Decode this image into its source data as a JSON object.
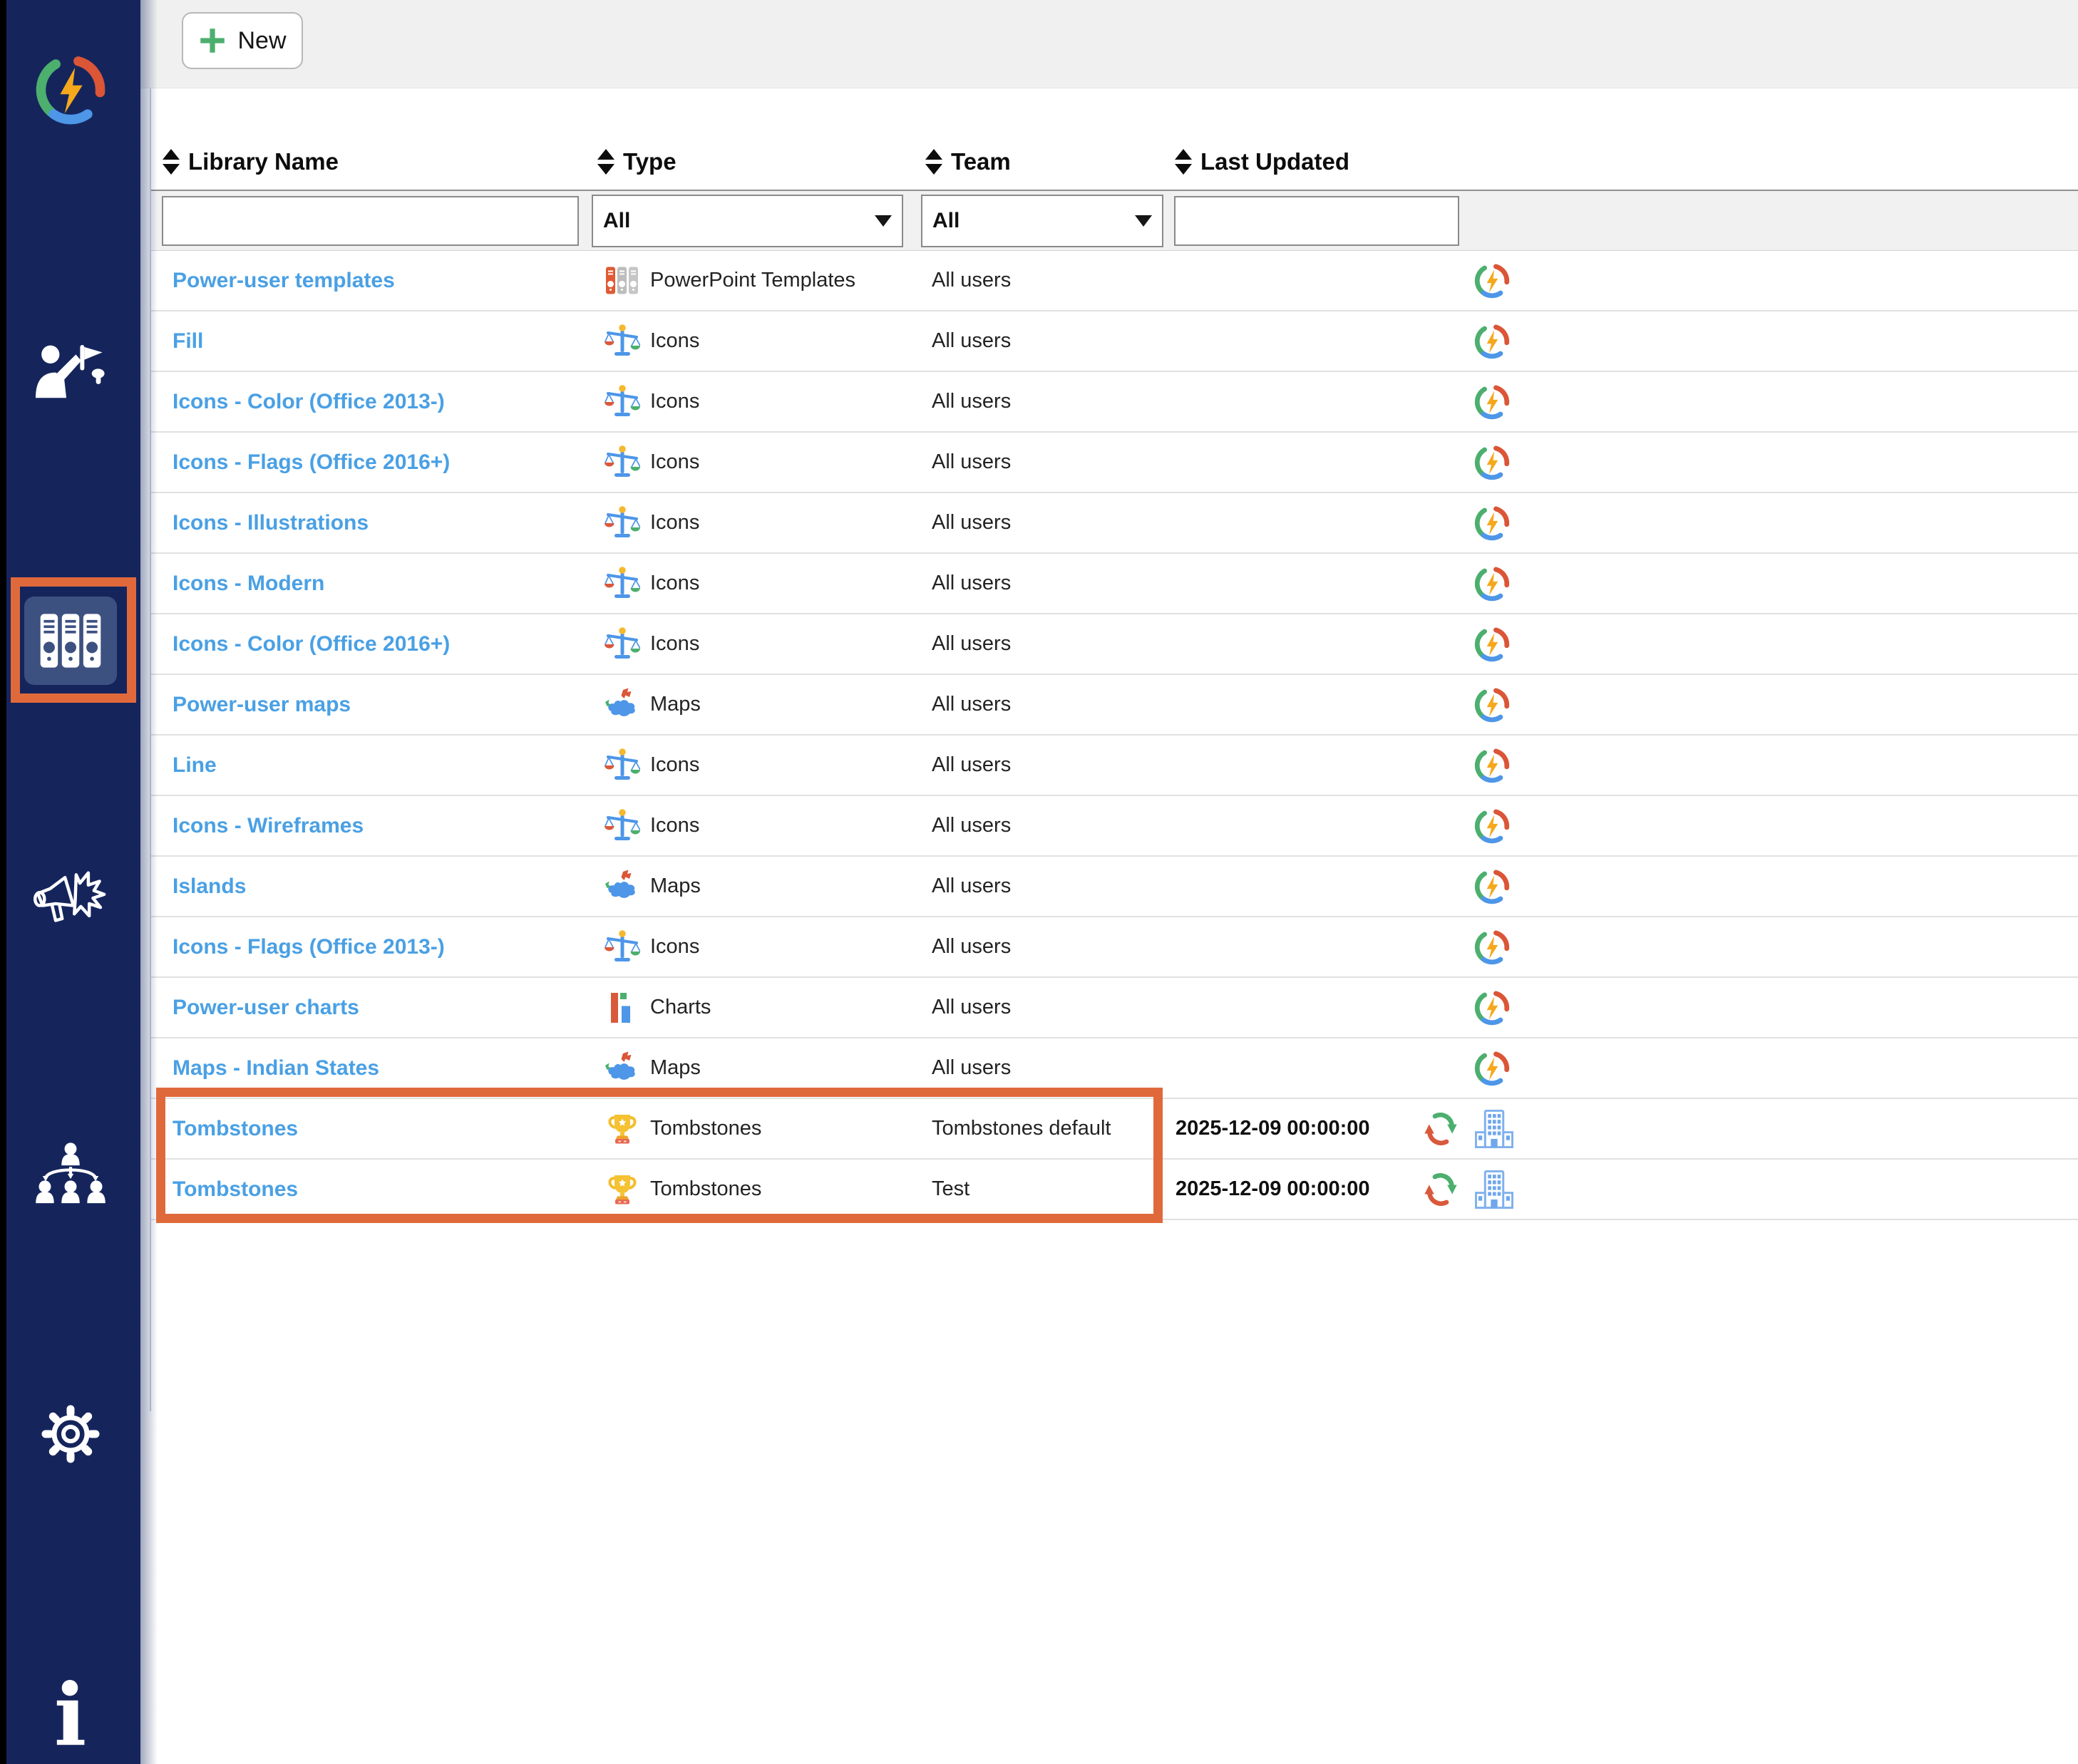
{
  "colors": {
    "sidebar_bg": "#15255C",
    "sidebar_active_bg": "#3D5181",
    "annotation_orange": "#E0693C",
    "link_blue": "#4AA0E4",
    "topbar_bg": "#F0F0F0",
    "filter_row_bg": "#F1F1F1",
    "new_plus_green": "#4CAF6E"
  },
  "topbar": {
    "new_button": {
      "label": "New",
      "icon": "plus-icon"
    }
  },
  "sidebar": {
    "items": [
      {
        "id": "app-logo",
        "icon": "app-logo-icon",
        "active": false,
        "highlighted": false
      },
      {
        "id": "presenter",
        "icon": "presenter-flag-icon",
        "active": false,
        "highlighted": false
      },
      {
        "id": "libraries",
        "icon": "library-binders-icon",
        "active": true,
        "highlighted": true
      },
      {
        "id": "announcements",
        "icon": "megaphone-burst-icon",
        "active": false,
        "highlighted": false
      },
      {
        "id": "team-hierarchy",
        "icon": "org-chart-icon",
        "active": false,
        "highlighted": false
      },
      {
        "id": "settings",
        "icon": "gear-icon",
        "active": false,
        "highlighted": false
      },
      {
        "id": "info",
        "icon": "info-icon",
        "active": false,
        "highlighted": false,
        "glyph": "i"
      }
    ]
  },
  "table": {
    "columns": [
      {
        "key": "name",
        "label": "Library Name",
        "sortable": true,
        "sort_icon": "sort-arrows-icon"
      },
      {
        "key": "type",
        "label": "Type",
        "sortable": true,
        "sort_icon": "sort-arrows-icon"
      },
      {
        "key": "team",
        "label": "Team",
        "sortable": true,
        "sort_icon": "sort-arrows-icon"
      },
      {
        "key": "updated",
        "label": "Last Updated",
        "sortable": true,
        "sort_icon": "sort-arrows-icon"
      }
    ],
    "filters": {
      "library_name": {
        "type": "text",
        "value": "",
        "placeholder": ""
      },
      "type": {
        "type": "select",
        "value": "All",
        "icon": "chevron-down-icon"
      },
      "team": {
        "type": "select",
        "value": "All",
        "icon": "chevron-down-icon"
      },
      "last_updated": {
        "type": "text",
        "value": "",
        "placeholder": ""
      }
    },
    "rows": [
      {
        "name": "Power-user templates",
        "type_icon": "powerpoint-templates",
        "type_label": "PowerPoint Templates",
        "team": "All users",
        "last_updated": "",
        "updated_icon": null,
        "action_icon": "app-logo-icon"
      },
      {
        "name": "Fill",
        "type_icon": "icons",
        "type_label": "Icons",
        "team": "All users",
        "last_updated": "",
        "updated_icon": null,
        "action_icon": "app-logo-icon"
      },
      {
        "name": "Icons - Color (Office 2013-)",
        "type_icon": "icons",
        "type_label": "Icons",
        "team": "All users",
        "last_updated": "",
        "updated_icon": null,
        "action_icon": "app-logo-icon"
      },
      {
        "name": "Icons - Flags (Office 2016+)",
        "type_icon": "icons",
        "type_label": "Icons",
        "team": "All users",
        "last_updated": "",
        "updated_icon": null,
        "action_icon": "app-logo-icon"
      },
      {
        "name": "Icons - Illustrations",
        "type_icon": "icons",
        "type_label": "Icons",
        "team": "All users",
        "last_updated": "",
        "updated_icon": null,
        "action_icon": "app-logo-icon"
      },
      {
        "name": "Icons - Modern",
        "type_icon": "icons",
        "type_label": "Icons",
        "team": "All users",
        "last_updated": "",
        "updated_icon": null,
        "action_icon": "app-logo-icon"
      },
      {
        "name": "Icons - Color (Office 2016+)",
        "type_icon": "icons",
        "type_label": "Icons",
        "team": "All users",
        "last_updated": "",
        "updated_icon": null,
        "action_icon": "app-logo-icon"
      },
      {
        "name": "Power-user maps",
        "type_icon": "maps",
        "type_label": "Maps",
        "team": "All users",
        "last_updated": "",
        "updated_icon": null,
        "action_icon": "app-logo-icon"
      },
      {
        "name": "Line",
        "type_icon": "icons",
        "type_label": "Icons",
        "team": "All users",
        "last_updated": "",
        "updated_icon": null,
        "action_icon": "app-logo-icon"
      },
      {
        "name": "Icons - Wireframes",
        "type_icon": "icons",
        "type_label": "Icons",
        "team": "All users",
        "last_updated": "",
        "updated_icon": null,
        "action_icon": "app-logo-icon"
      },
      {
        "name": "Islands",
        "type_icon": "maps",
        "type_label": "Maps",
        "team": "All users",
        "last_updated": "",
        "updated_icon": null,
        "action_icon": "app-logo-icon"
      },
      {
        "name": "Icons - Flags (Office 2013-)",
        "type_icon": "icons",
        "type_label": "Icons",
        "team": "All users",
        "last_updated": "",
        "updated_icon": null,
        "action_icon": "app-logo-icon"
      },
      {
        "name": "Power-user charts",
        "type_icon": "charts",
        "type_label": "Charts",
        "team": "All users",
        "last_updated": "",
        "updated_icon": null,
        "action_icon": "app-logo-icon"
      },
      {
        "name": "Maps - Indian States",
        "type_icon": "maps",
        "type_label": "Maps",
        "team": "All users",
        "last_updated": "",
        "updated_icon": null,
        "action_icon": "app-logo-icon"
      },
      {
        "name": "Tombstones",
        "type_icon": "tombstones",
        "type_label": "Tombstones",
        "team": "Tombstones default",
        "last_updated": "2025-12-09 00:00:00",
        "updated_icon": "sync-arrows-icon",
        "action_icon": "building-icon"
      },
      {
        "name": "Tombstones",
        "type_icon": "tombstones",
        "type_label": "Tombstones",
        "team": "Test",
        "last_updated": "2025-12-09 00:00:00",
        "updated_icon": "sync-arrows-icon",
        "action_icon": "building-icon"
      }
    ]
  },
  "annotations": {
    "color": "#E0693C",
    "boxes": [
      {
        "target": "sidebar-libraries-item"
      },
      {
        "target": "tombstones-rows"
      }
    ]
  }
}
